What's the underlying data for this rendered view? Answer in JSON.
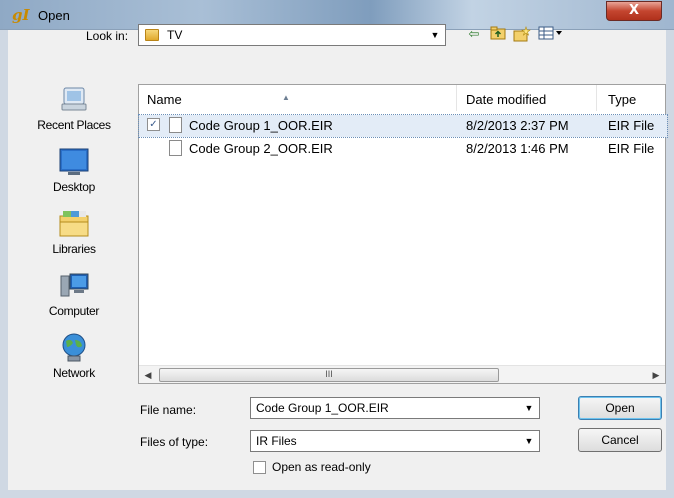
{
  "window": {
    "title": "Open",
    "app_icon_glyph": "gI",
    "close_glyph": "X"
  },
  "toolbar": {
    "look_in_label": "Look in:",
    "look_in_value": "TV",
    "back_icon": "back-arrow-icon",
    "up_icon": "up-folder-icon",
    "new_folder_icon": "new-folder-icon",
    "views_icon": "views-menu-icon"
  },
  "places": [
    {
      "label": "Recent Places",
      "icon": "recent-places-icon"
    },
    {
      "label": "Desktop",
      "icon": "desktop-icon"
    },
    {
      "label": "Libraries",
      "icon": "libraries-icon"
    },
    {
      "label": "Computer",
      "icon": "computer-icon"
    },
    {
      "label": "Network",
      "icon": "network-icon"
    }
  ],
  "file_list": {
    "columns": [
      "Name",
      "Date modified",
      "Type"
    ],
    "rows": [
      {
        "name": "Code Group 1_OOR.EIR",
        "date": "8/2/2013 2:37 PM",
        "type": "EIR File",
        "selected": true
      },
      {
        "name": "Code Group 2_OOR.EIR",
        "date": "8/2/2013 1:46 PM",
        "type": "EIR File",
        "selected": false
      }
    ],
    "scroll_thumb_glyph": "III"
  },
  "form": {
    "file_name_label": "File name:",
    "file_name_value": "Code Group 1_OOR.EIR",
    "file_type_label": "Files of type:",
    "file_type_value": "IR Files",
    "read_only_label": "Open as read-only"
  },
  "buttons": {
    "open": "Open",
    "cancel": "Cancel"
  },
  "colors": {
    "selection": "#e3ecf7",
    "close_button": "#c4452f",
    "titlebar": "#a9bfd6"
  }
}
